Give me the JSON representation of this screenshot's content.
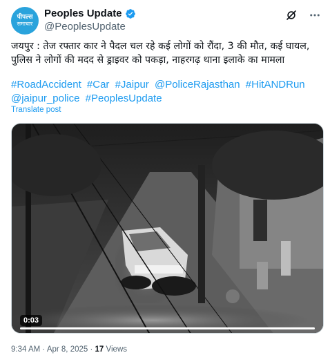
{
  "author": {
    "display_name": "Peoples Update",
    "handle": "@PeoplesUpdate",
    "avatar_line1": "पीपल्स",
    "avatar_line2": "समाचार",
    "avatar_color": "#2aa3dc",
    "verified": true
  },
  "post": {
    "text": "जयपुर : तेज रफ्तार कार ने पैदल चल रहे कई लोगों को रौंदा, 3 की मौत, कई घायल, पुलिस ने लोगों की मदद से ड्राइवर को पकड़ा, नाहरगढ़ थाना इलाके का मामला",
    "hashtags": [
      "#RoadAccident",
      "#Car",
      "#Jaipur",
      "@PoliceRajasthan",
      "#HitANDRun",
      "@jaipur_police",
      "#PeoplesUpdate"
    ],
    "translate_label": "Translate post",
    "link_color": "#1d9bf0"
  },
  "media": {
    "duration": "0:03",
    "progress": 1.0
  },
  "meta": {
    "time": "9:34 AM",
    "separator": "·",
    "date": "Apr 8, 2025",
    "views_count": "17",
    "views_label": "Views"
  },
  "icons": {
    "grok": "grok-icon",
    "more": "more-icon",
    "verified": "verified-badge-icon"
  }
}
